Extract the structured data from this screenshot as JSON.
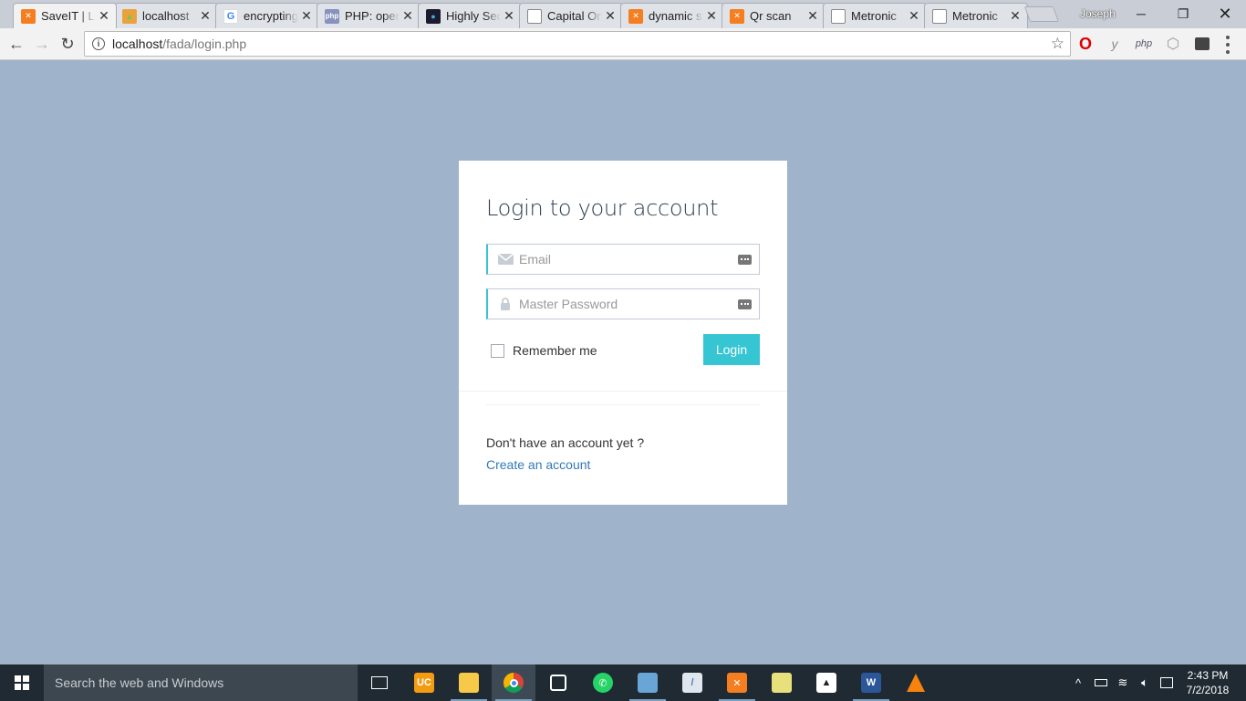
{
  "browser": {
    "tabs": [
      {
        "title": "SaveIT | Login",
        "favicon": "xampp-icon",
        "active": true
      },
      {
        "title": "localhost",
        "favicon": "phpmyadmin-icon",
        "active": false
      },
      {
        "title": "encrypting",
        "favicon": "google-icon",
        "active": false
      },
      {
        "title": "PHP: openssl",
        "favicon": "php-icon",
        "active": false
      },
      {
        "title": "Highly Secure",
        "favicon": "dark-app-icon",
        "active": false
      },
      {
        "title": "Capital One",
        "favicon": "page-icon",
        "active": false
      },
      {
        "title": "dynamic s",
        "favicon": "xampp-icon",
        "active": false
      },
      {
        "title": "Qr scan",
        "favicon": "xampp-icon",
        "active": false
      },
      {
        "title": "Metronic",
        "favicon": "page-icon",
        "active": false
      },
      {
        "title": "Metronic",
        "favicon": "page-icon",
        "active": false
      }
    ],
    "profile_name": "Joseph",
    "address": {
      "host": "localhost",
      "path": "/fada/login.php"
    },
    "extensions": [
      "opera-icon",
      "y-extension-icon",
      "php-extension-icon",
      "shield-extension-icon",
      "dark-extension-icon"
    ]
  },
  "login": {
    "title": "Login to your account",
    "email_placeholder": "Email",
    "password_placeholder": "Master Password",
    "remember_label": "Remember me",
    "login_button": "Login",
    "no_account_text": "Don't have an account yet ?",
    "create_account_link": "Create an account"
  },
  "taskbar": {
    "search_placeholder": "Search the web and Windows",
    "apps": [
      "task-view-icon",
      "uc-browser-icon",
      "file-explorer-icon",
      "chrome-icon",
      "store-icon",
      "whatsapp-icon",
      "virtualbox-icon",
      "sublime-icon",
      "xampp-icon",
      "sticky-notes-icon",
      "photos-icon",
      "word-icon",
      "vlc-icon"
    ],
    "time": "2:43 PM",
    "date": "7/2/2018"
  },
  "colors": {
    "page_bg": "#9fb3ca",
    "accent": "#36c6d3",
    "link": "#337ab7",
    "taskbar": "#1f2a33"
  }
}
